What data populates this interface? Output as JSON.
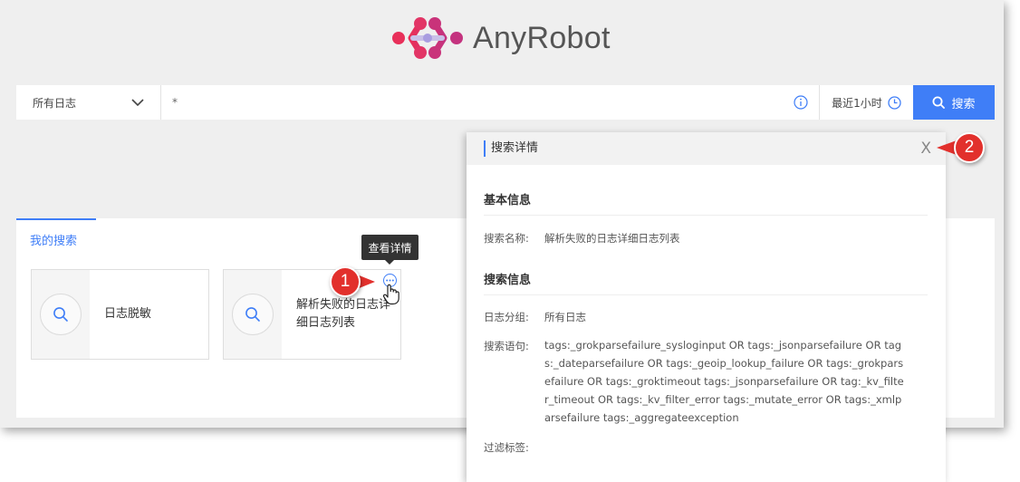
{
  "app": {
    "logo_text": "AnyRobot"
  },
  "search_bar": {
    "group_select": "所有日志",
    "query_value": "*",
    "time_range": "最近1小时",
    "search_button": "搜索"
  },
  "my_search": {
    "tab_label": "我的搜索",
    "cards": [
      {
        "label": "日志脱敏"
      },
      {
        "label": "解析失败的日志详细日志列表"
      }
    ],
    "tooltip": "查看详情"
  },
  "detail": {
    "title": "搜索详情",
    "close": "X",
    "basic_section": "基本信息",
    "name_label": "搜索名称:",
    "name_value": "解析失败的日志详细日志列表",
    "search_section": "搜索信息",
    "group_label": "日志分组:",
    "group_value": "所有日志",
    "query_label": "搜索语句:",
    "query_value": "tags:_grokparsefailure_sysloginput OR tags:_jsonparsefailure OR tags:_dateparsefailure OR tags:_geoip_lookup_failure OR tags:_grokparsefailure OR tags:_groktimeout tags:_jsonparsefailure OR tag:_kv_filter_timeout OR tags:_kv_filter_error tags:_mutate_error OR tags:_xmlparsefailure tags:_aggregateexception",
    "tags_label": "过滤标签:"
  },
  "callouts": [
    "1",
    "2"
  ],
  "colors": {
    "accent": "#3f7ef7",
    "callout": "#e2302c",
    "logo": "#d9336b"
  },
  "icons": [
    "anyrobot-logo-icon",
    "chevron-down-icon",
    "info-icon",
    "clock-icon",
    "search-icon",
    "more-icon",
    "hand-cursor-icon",
    "close-icon"
  ]
}
